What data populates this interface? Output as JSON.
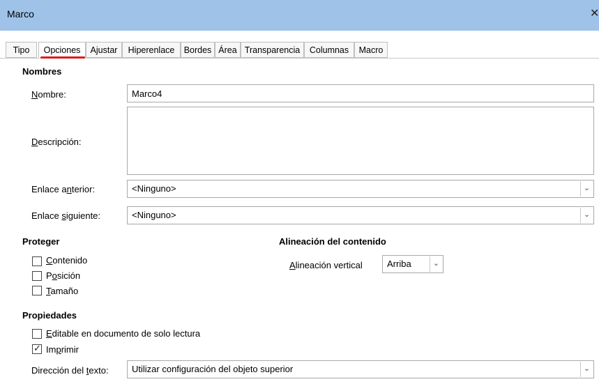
{
  "window": {
    "title": "Marco",
    "close_glyph": "✕"
  },
  "tabs": [
    {
      "label": "Tipo"
    },
    {
      "label": "Opciones",
      "active": true
    },
    {
      "label": "Ajustar"
    },
    {
      "label": "Hiperenlace"
    },
    {
      "label": "Bordes"
    },
    {
      "label": "Área"
    },
    {
      "label": "Transparencia"
    },
    {
      "label": "Columnas"
    },
    {
      "label": "Macro"
    }
  ],
  "nombres": {
    "heading": "Nombres",
    "nombre": {
      "label_u": "N",
      "label_rest": "ombre:",
      "value": "Marco4"
    },
    "descripcion": {
      "label_u": "D",
      "label_rest": "escripción:",
      "value": ""
    },
    "enlace_anterior": {
      "label_pre": "Enlace a",
      "label_u": "n",
      "label_rest": "terior:",
      "value": "<Ninguno>"
    },
    "enlace_siguiente": {
      "label_pre": "Enlace ",
      "label_u": "s",
      "label_rest": "iguiente:",
      "value": "<Ninguno>"
    }
  },
  "proteger": {
    "heading": "Proteger",
    "contenido": {
      "u": "C",
      "rest": "ontenido",
      "checked": false
    },
    "posicion": {
      "pre": "P",
      "u": "o",
      "rest": "sición",
      "checked": false
    },
    "tamano": {
      "u": "T",
      "rest": "amaño",
      "checked": false
    }
  },
  "alineacion": {
    "heading": "Alineación del contenido",
    "label_u": "A",
    "label_rest": "lineación vertical",
    "value": "Arriba"
  },
  "propiedades": {
    "heading": "Propiedades",
    "editable": {
      "u": "E",
      "rest": "ditable en documento de solo lectura",
      "checked": false
    },
    "imprimir": {
      "pre": "Im",
      "u": "p",
      "rest": "rimir",
      "checked": true
    },
    "direccion": {
      "label_pre": "Dirección del ",
      "label_u": "t",
      "label_rest": "exto:",
      "value": "Utilizar configuración del objeto superior"
    }
  },
  "icons": {
    "chevron": "chevron-down-icon",
    "check": "checkmark-icon"
  }
}
